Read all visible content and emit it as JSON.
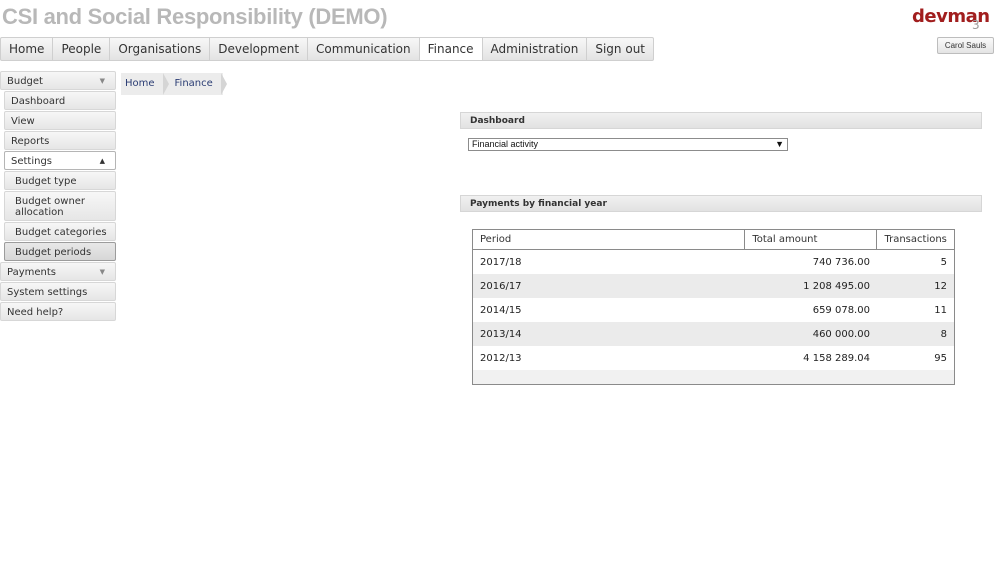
{
  "app": {
    "title": "CSI and Social Responsibility (DEMO)",
    "logo": "devman",
    "logo_number": "3",
    "user": "Carol Sauls"
  },
  "topnav": [
    "Home",
    "People",
    "Organisations",
    "Development",
    "Communication",
    "Finance",
    "Administration",
    "Sign out"
  ],
  "active_tab": "Finance",
  "sidebar": {
    "budget": "Budget",
    "budget_items": [
      "Dashboard",
      "View",
      "Reports"
    ],
    "settings": "Settings",
    "settings_items": [
      "Budget type",
      "Budget owner allocation",
      "Budget categories",
      "Budget periods"
    ],
    "payments": "Payments",
    "system_settings": "System settings",
    "need_help": "Need help?"
  },
  "breadcrumb": [
    "Home",
    "Finance"
  ],
  "dashboard": {
    "heading": "Dashboard",
    "selected": "Financial activity"
  },
  "payments": {
    "heading": "Payments by financial year",
    "columns": [
      "Period",
      "Total amount",
      "Transactions"
    ],
    "rows": [
      {
        "period": "2017/18",
        "total": "740 736.00",
        "transactions": "5"
      },
      {
        "period": "2016/17",
        "total": "1 208 495.00",
        "transactions": "12"
      },
      {
        "period": "2014/15",
        "total": "659 078.00",
        "transactions": "11"
      },
      {
        "period": "2013/14",
        "total": "460 000.00",
        "transactions": "8"
      },
      {
        "period": "2012/13",
        "total": "4 158 289.04",
        "transactions": "95"
      }
    ]
  }
}
